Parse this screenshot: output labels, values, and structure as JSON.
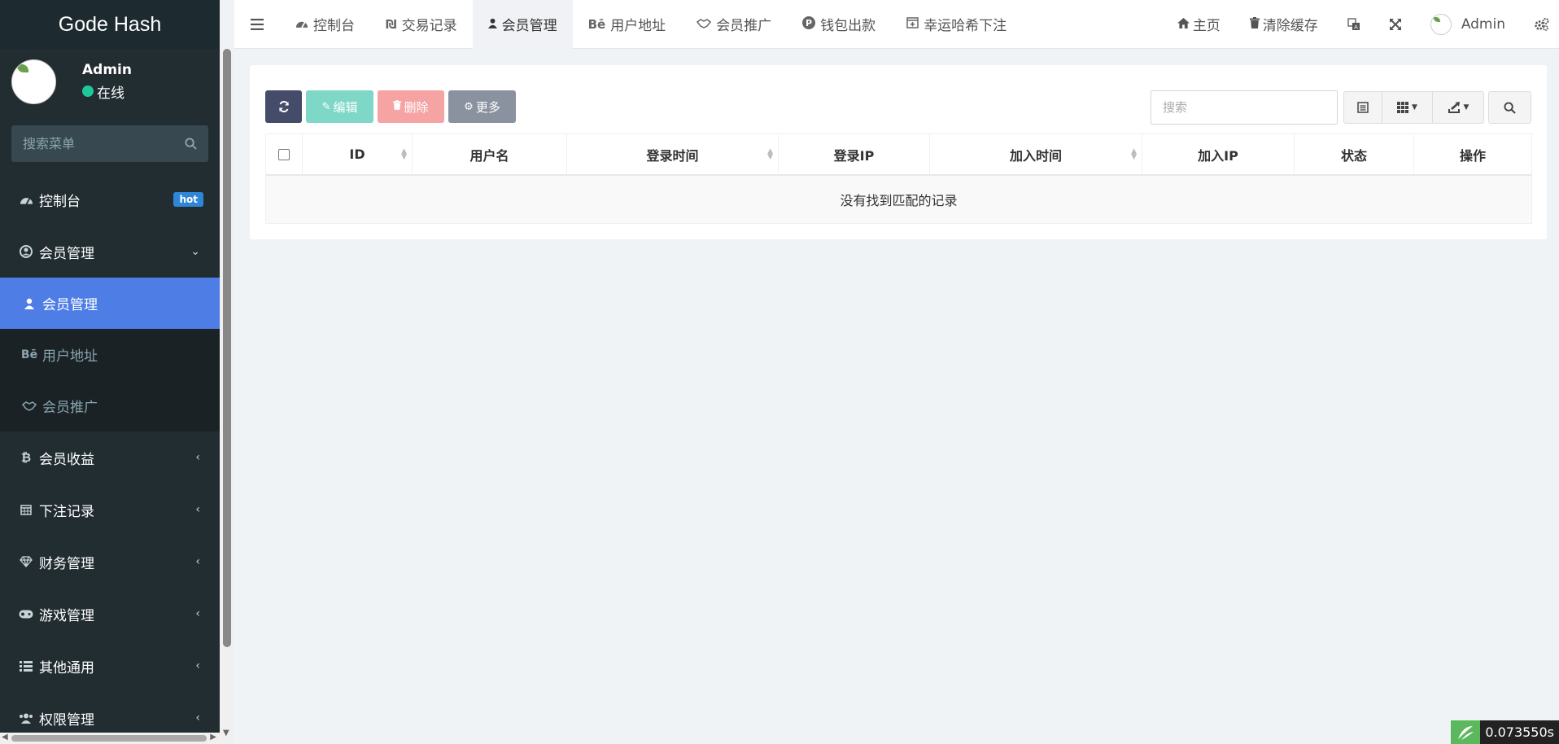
{
  "brand": {
    "title": "Gode Hash"
  },
  "user": {
    "name": "Admin",
    "status": "在线"
  },
  "sidebar": {
    "search_placeholder": "搜索菜单",
    "items": [
      {
        "label": "控制台",
        "badge": "hot"
      },
      {
        "label": "会员管理"
      },
      {
        "label": "会员收益"
      },
      {
        "label": "下注记录"
      },
      {
        "label": "财务管理"
      },
      {
        "label": "游戏管理"
      },
      {
        "label": "其他通用"
      },
      {
        "label": "权限管理"
      }
    ],
    "submenu": [
      {
        "label": "会员管理",
        "active": true
      },
      {
        "label": "用户地址"
      },
      {
        "label": "会员推广"
      }
    ]
  },
  "header": {
    "tabs": [
      {
        "label": "控制台"
      },
      {
        "label": "交易记录"
      },
      {
        "label": "会员管理",
        "active": true
      },
      {
        "label": "用户地址"
      },
      {
        "label": "会员推广"
      },
      {
        "label": "钱包出款"
      },
      {
        "label": "幸运哈希下注"
      }
    ],
    "home": "主页",
    "clear_cache": "清除缓存",
    "admin_name": "Admin"
  },
  "toolbar": {
    "edit": "编辑",
    "delete": "删除",
    "more": "更多",
    "search_placeholder": "搜索"
  },
  "table": {
    "columns": [
      "ID",
      "用户名",
      "登录时间",
      "登录IP",
      "加入时间",
      "加入IP",
      "状态",
      "操作"
    ],
    "empty_text": "没有找到匹配的记录"
  },
  "timer": {
    "value": "0.073550s"
  },
  "colors": {
    "sidebar_bg": "#222d32",
    "active_item": "#4e7de6",
    "online": "#1ec89b",
    "btn_refresh": "#444c69",
    "btn_edit": "#7fd8c7",
    "btn_delete": "#f5a3a3",
    "btn_more": "#8a92a0"
  }
}
